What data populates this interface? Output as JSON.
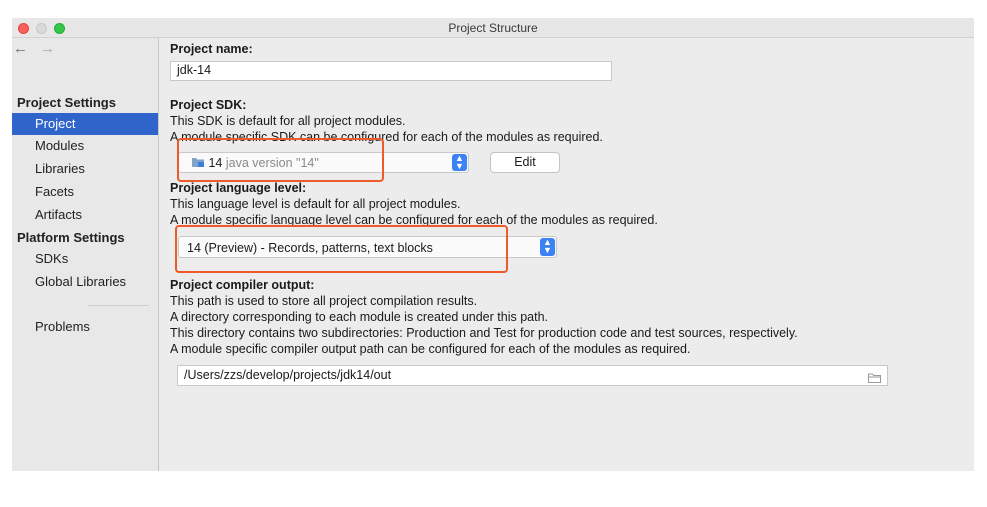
{
  "window": {
    "title": "Project Structure"
  },
  "nav": {
    "back": "←",
    "forward": "→"
  },
  "sidebar": {
    "project_settings_heading": "Project Settings",
    "project_settings_items": [
      "Project",
      "Modules",
      "Libraries",
      "Facets",
      "Artifacts"
    ],
    "platform_settings_heading": "Platform Settings",
    "platform_settings_items": [
      "SDKs",
      "Global Libraries"
    ],
    "extra_items": [
      "Problems"
    ],
    "selected": "Project"
  },
  "project_name": {
    "label": "Project name:",
    "value": "jdk-14"
  },
  "project_sdk": {
    "label": "Project SDK:",
    "desc1": "This SDK is default for all project modules.",
    "desc2": "A module specific SDK can be configured for each of the modules as required.",
    "selected_version": "14",
    "selected_detail": "java version \"14\"",
    "edit_button": "Edit"
  },
  "language_level": {
    "label": "Project language level:",
    "desc1": "This language level is default for all project modules.",
    "desc2": "A module specific language level can be configured for each of the modules as required.",
    "selected": "14 (Preview) - Records, patterns, text blocks"
  },
  "compiler_output": {
    "label": "Project compiler output:",
    "desc1": "This path is used to store all project compilation results.",
    "desc2": "A directory corresponding to each module is created under this path.",
    "desc3": "This directory contains two subdirectories: Production and Test for production code and test sources, respectively.",
    "desc4": "A module specific compiler output path can be configured for each of the modules as required.",
    "path": "/Users/zzs/develop/projects/jdk14/out"
  },
  "colors": {
    "selection": "#2f65ca",
    "highlight_annotation": "#ee5a2b",
    "combo_arrow": "#3d82f5"
  }
}
